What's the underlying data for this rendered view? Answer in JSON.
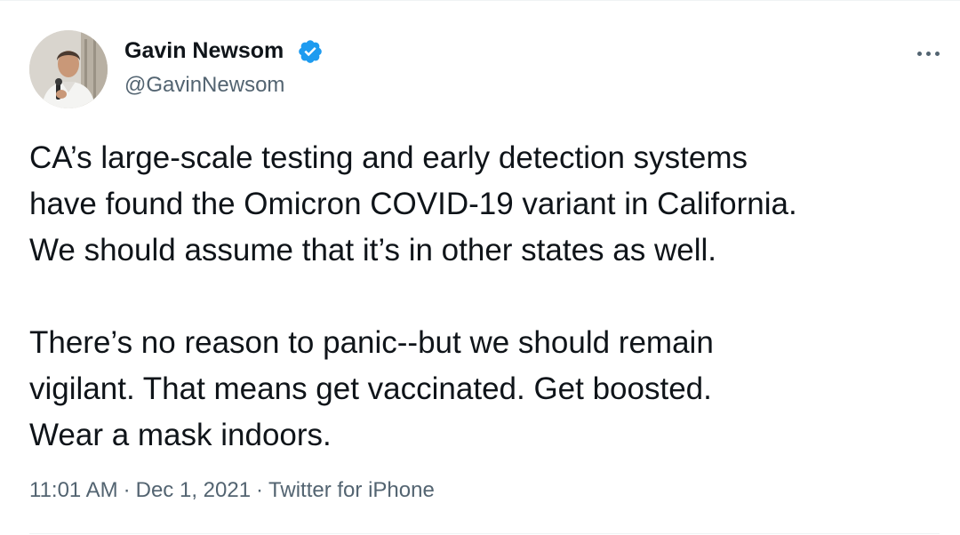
{
  "author": {
    "name": "Gavin Newsom",
    "handle": "@GavinNewsom",
    "verified": true,
    "avatar_icon": "profile-photo"
  },
  "tweet": {
    "paragraphs": [
      "CA’s large-scale testing and early detection systems\nhave found the Omicron COVID-19 variant in California.\nWe should assume that it’s in other states as well.",
      "There’s no reason to panic--but we should remain\nvigilant. That means get vaccinated. Get boosted.\nWear a mask indoors."
    ]
  },
  "meta": {
    "time": "11:01 AM",
    "date": "Dec 1, 2021",
    "source": "Twitter for iPhone",
    "separator": "·"
  },
  "icons": {
    "verified": "verified-badge-icon",
    "more": "more-options-icon"
  },
  "colors": {
    "text_primary": "#0f1419",
    "text_secondary": "#536471",
    "verified_blue": "#1d9bf0",
    "divider": "#eff3f4"
  }
}
